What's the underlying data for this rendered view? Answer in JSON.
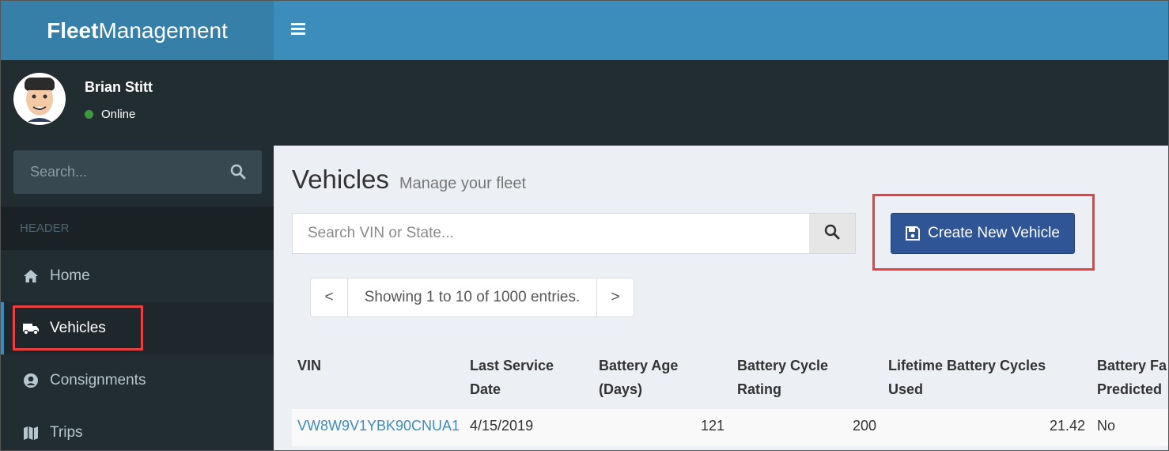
{
  "brand": {
    "bold": "Fleet",
    "regular": "Management"
  },
  "user": {
    "name": "Brian Stitt",
    "status": "Online"
  },
  "sidebar": {
    "search_placeholder": "Search...",
    "header": "HEADER",
    "items": [
      {
        "label": "Home",
        "icon": "home-icon"
      },
      {
        "label": "Vehicles",
        "icon": "truck-icon"
      },
      {
        "label": "Consignments",
        "icon": "user-circle-icon"
      },
      {
        "label": "Trips",
        "icon": "map-icon"
      }
    ]
  },
  "page": {
    "title": "Vehicles",
    "subtitle": "Manage your fleet"
  },
  "search": {
    "placeholder": "Search VIN or State..."
  },
  "create_button": {
    "label": "Create New Vehicle"
  },
  "pager": {
    "prev": "<",
    "info": "Showing 1 to 10 of 1000 entries.",
    "next": ">"
  },
  "table": {
    "headers": [
      [
        "",
        "VIN"
      ],
      [
        "Last Service",
        "Date"
      ],
      [
        "Battery Age",
        "(Days)"
      ],
      [
        "Battery Cycle",
        "Rating"
      ],
      [
        "Lifetime Battery Cycles",
        "Used"
      ],
      [
        "Battery Fa",
        "Predicted"
      ]
    ],
    "rows": [
      [
        "VW8W9V1YBK90CNUA1",
        "4/15/2019",
        "121",
        "200",
        "21.42",
        "No"
      ]
    ]
  },
  "colors": {
    "topbar": "#3c8dbc",
    "sidebar": "#222d32",
    "accent_button": "#2f5597",
    "highlight": "#e84040",
    "link": "#3c8dbc"
  }
}
